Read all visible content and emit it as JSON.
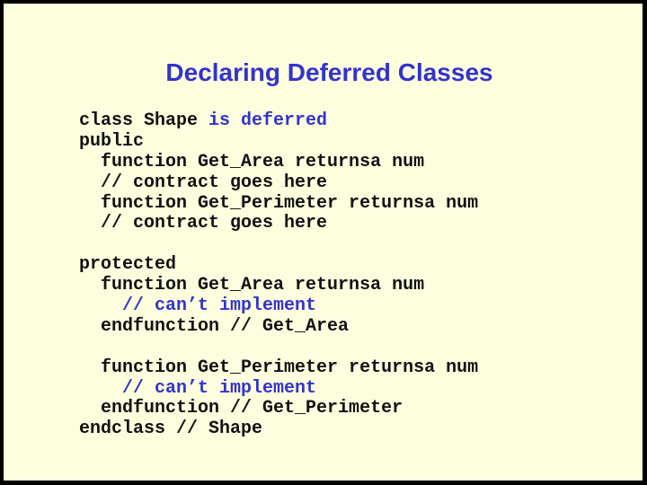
{
  "slide": {
    "title": "Declaring Deferred Classes",
    "colors": {
      "background": "#fdfede",
      "border": "#000000",
      "title": "#3333cc",
      "code": "#111111",
      "highlight": "#3333cc"
    },
    "code_lines": [
      {
        "indent": "",
        "segments": [
          {
            "text": "class Shape ",
            "style": "normal"
          },
          {
            "text": "is deferred",
            "style": "blue"
          }
        ]
      },
      {
        "indent": "",
        "segments": [
          {
            "text": "public",
            "style": "normal"
          }
        ]
      },
      {
        "indent": "  ",
        "segments": [
          {
            "text": "function Get_Area returnsa num",
            "style": "normal"
          }
        ]
      },
      {
        "indent": "  ",
        "segments": [
          {
            "text": "// contract goes here",
            "style": "normal"
          }
        ]
      },
      {
        "indent": "  ",
        "segments": [
          {
            "text": "function Get_Perimeter returnsa num",
            "style": "normal"
          }
        ]
      },
      {
        "indent": "  ",
        "segments": [
          {
            "text": "// contract goes here",
            "style": "normal"
          }
        ]
      },
      {
        "indent": "",
        "segments": [
          {
            "text": "",
            "style": "normal"
          }
        ]
      },
      {
        "indent": "",
        "segments": [
          {
            "text": "protected",
            "style": "normal"
          }
        ]
      },
      {
        "indent": "  ",
        "segments": [
          {
            "text": "function Get_Area returnsa num",
            "style": "normal"
          }
        ]
      },
      {
        "indent": "    ",
        "segments": [
          {
            "text": "// can’t implement",
            "style": "blue"
          }
        ]
      },
      {
        "indent": "  ",
        "segments": [
          {
            "text": "endfunction // Get_Area",
            "style": "normal"
          }
        ]
      },
      {
        "indent": "",
        "segments": [
          {
            "text": "",
            "style": "normal"
          }
        ]
      },
      {
        "indent": "  ",
        "segments": [
          {
            "text": "function Get_Perimeter returnsa num",
            "style": "normal"
          }
        ]
      },
      {
        "indent": "    ",
        "segments": [
          {
            "text": "// can’t implement",
            "style": "blue"
          }
        ]
      },
      {
        "indent": "  ",
        "segments": [
          {
            "text": "endfunction // Get_Perimeter",
            "style": "normal"
          }
        ]
      },
      {
        "indent": "",
        "segments": [
          {
            "text": "endclass // Shape",
            "style": "normal"
          }
        ]
      }
    ]
  }
}
